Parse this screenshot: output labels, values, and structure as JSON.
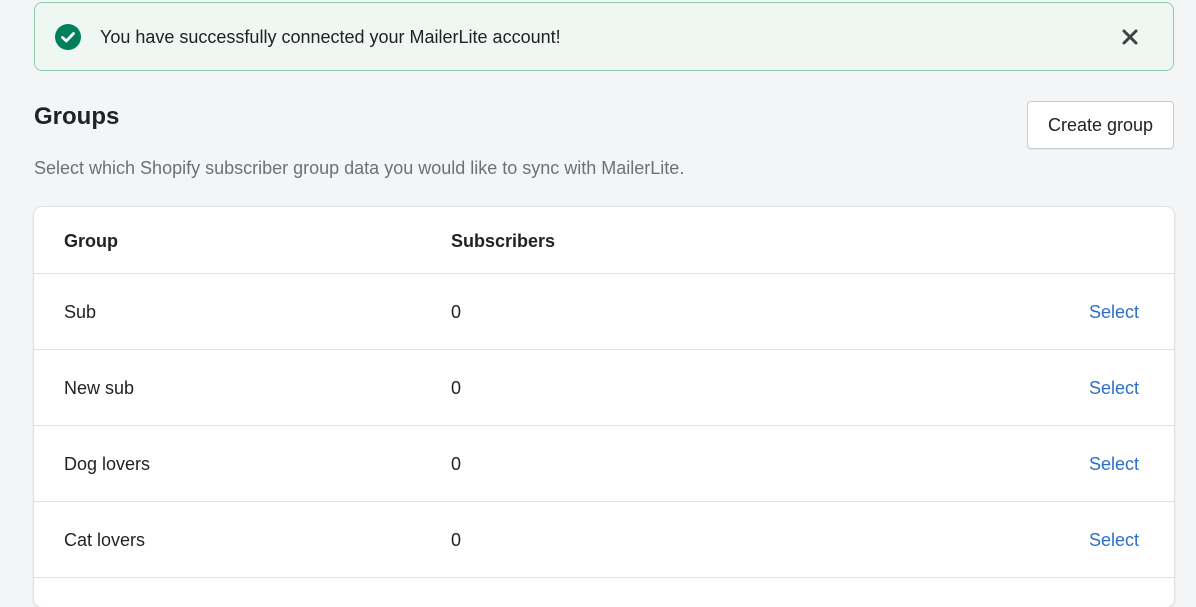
{
  "banner": {
    "message": "You have successfully connected your MailerLite account!",
    "status_color": "#007f5f"
  },
  "header": {
    "title": "Groups",
    "create_button": "Create group",
    "subtitle": "Select which Shopify subscriber group data you would like to sync with MailerLite."
  },
  "table": {
    "columns": [
      "Group",
      "Subscribers"
    ],
    "rows": [
      {
        "group": "Sub",
        "subscribers": "0",
        "action": "Select"
      },
      {
        "group": "New sub",
        "subscribers": "0",
        "action": "Select"
      },
      {
        "group": "Dog lovers",
        "subscribers": "0",
        "action": "Select"
      },
      {
        "group": "Cat lovers",
        "subscribers": "0",
        "action": "Select"
      }
    ]
  }
}
